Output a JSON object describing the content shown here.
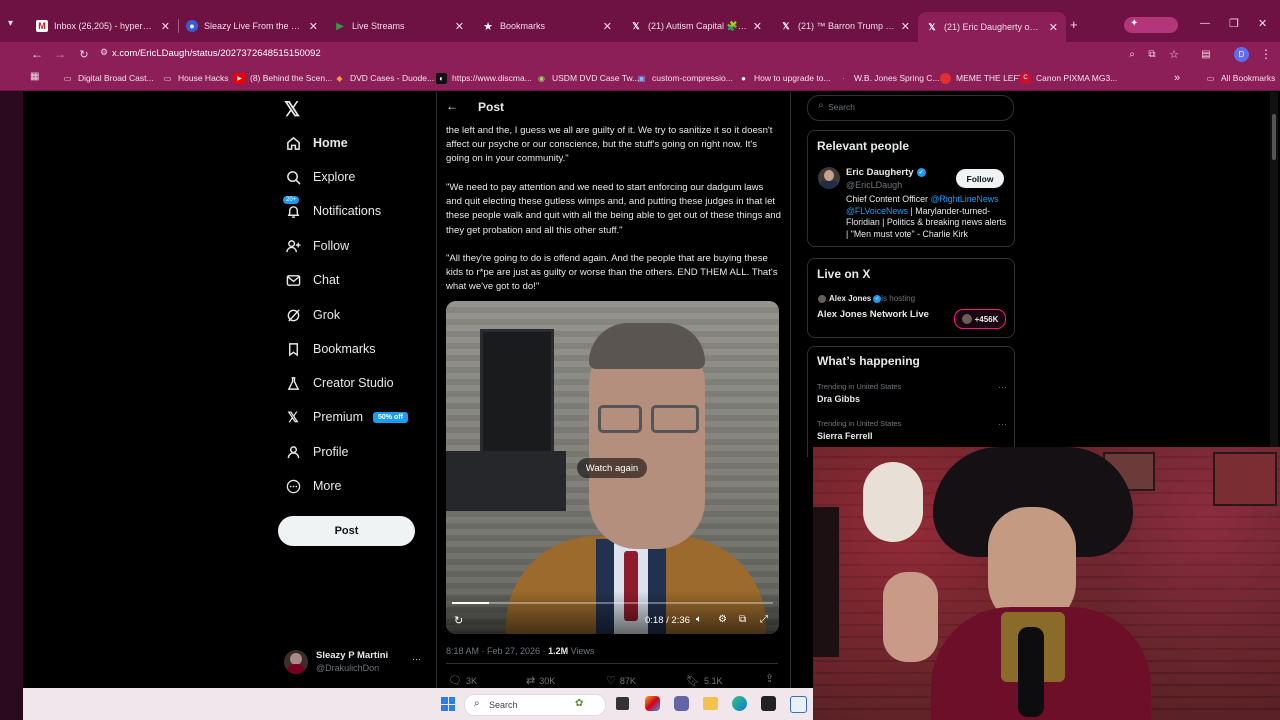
{
  "browser": {
    "tabs": [
      {
        "label": "Inbox (26,205) - hyperealpro",
        "icon": "gmail-icon",
        "color": "#c5221f"
      },
      {
        "label": "Sleazy Live From the Bunker",
        "icon": "site-icon",
        "color": "#3a5bd9"
      },
      {
        "label": "Live Streams",
        "icon": "play-icon",
        "color": "#2ea043"
      },
      {
        "label": "Bookmarks",
        "icon": "star-icon",
        "color": "#ffffff"
      },
      {
        "label": "(21) Autism Capital 🧩 on X:",
        "icon": "x-icon",
        "color": "#ffffff"
      },
      {
        "label": "(21) ™ Barron Trump us on",
        "icon": "x-icon",
        "color": "#ffffff"
      },
      {
        "label": "(21) Eric Daugherty on X: \"",
        "icon": "x-icon",
        "color": "#ffffff"
      }
    ],
    "url": "x.com/EricLDaugh/status/2027372648515150092",
    "bookmarks": [
      "Digital Broad Cast...",
      "House Hacks",
      "(8) Behind the Scen...",
      "DVD Cases - Duode...",
      "https://www.discma...",
      "USDM DVD Case Tw...",
      "custom-compressio...",
      "How to upgrade to...",
      "W.B. Jones Spring C...",
      "MEME THE LEFT",
      "Canon PIXMA MG3..."
    ],
    "all_bookmarks": "All Bookmarks",
    "more_bookmarks": "»",
    "profile_initial": "D"
  },
  "sidebar": {
    "logo": "𝕏",
    "items": [
      {
        "label": "Home",
        "icon": "home-icon"
      },
      {
        "label": "Explore",
        "icon": "search-icon"
      },
      {
        "label": "Notifications",
        "icon": "bell-icon",
        "badge": "20+"
      },
      {
        "label": "Follow",
        "icon": "add-person-icon"
      },
      {
        "label": "Chat",
        "icon": "mail-icon"
      },
      {
        "label": "Grok",
        "icon": "grok-icon"
      },
      {
        "label": "Bookmarks",
        "icon": "bookmark-icon"
      },
      {
        "label": "Creator Studio",
        "icon": "flask-icon"
      },
      {
        "label": "Premium",
        "icon": "x-icon",
        "badge": "50% off"
      },
      {
        "label": "Profile",
        "icon": "person-icon"
      },
      {
        "label": "More",
        "icon": "more-circle-icon"
      }
    ],
    "post_button": "Post",
    "account": {
      "name": "Sleazy P Martini",
      "handle": "@DrakulichDon",
      "more": "···"
    }
  },
  "post": {
    "header_title": "Post",
    "paragraphs": [
      "the left and the, I guess we all are guilty of it. We try to sanitize it so it doesn't affect our psyche or our conscience, but the stuff's going on right now. It's going on in your community.\"",
      "\"We need to pay attention and we need to start enforcing our dadgum laws and quit electing these gutless wimps and, and putting these judges in that let these people walk and quit with all the being able to get out of these things and they get probation and all this other stuff.\"",
      "\"All they're going to do is offend again. And the people that are buying these kids to r*pe are just as guilty or worse than the others. END THEM ALL. That's what we've got to do!\""
    ],
    "video": {
      "overlay": "Watch again",
      "time": "0:18 / 2:36",
      "progress": 0.115
    },
    "meta_time": "8:18 AM · Feb 27, 2026 · ",
    "views_count": "1.2M",
    "views_label": " Views",
    "actions": {
      "replies": "3K",
      "reposts": "30K",
      "likes": "87K",
      "bookmarks": "5.1K"
    }
  },
  "right": {
    "search_placeholder": "Search",
    "relevant": {
      "title": "Relevant people",
      "name": "Eric Daugherty",
      "handle": "@EricLDaugh",
      "follow": "Follow",
      "bio_prefix": "Chief Content Officer ",
      "bio_link1": "@RightLineNews",
      "bio_link2": "@FLVoiceNews",
      "bio_rest": " | Marylander-turned-Floridian | Politics & breaking news alerts | \"Men must vote\" - Charlie Kirk"
    },
    "live": {
      "title": "Live on X",
      "host": "Alex Jones",
      "hosting": " is hosting",
      "show": "Alex Jones Network Live",
      "count": "+456K"
    },
    "happening": {
      "title": "What’s happening",
      "trends": [
        {
          "context": "Trending in United States",
          "name": "Dra Gibbs"
        },
        {
          "context": "Trending in United States",
          "name": "Sierra Ferrell"
        }
      ]
    }
  },
  "taskbar": {
    "search_placeholder": "Search"
  },
  "colors": {
    "tab_bg": "#6e1244",
    "toolbar_bg": "#8c1e58",
    "x_blue": "#1d9bf0",
    "live_red": "#f91880"
  }
}
